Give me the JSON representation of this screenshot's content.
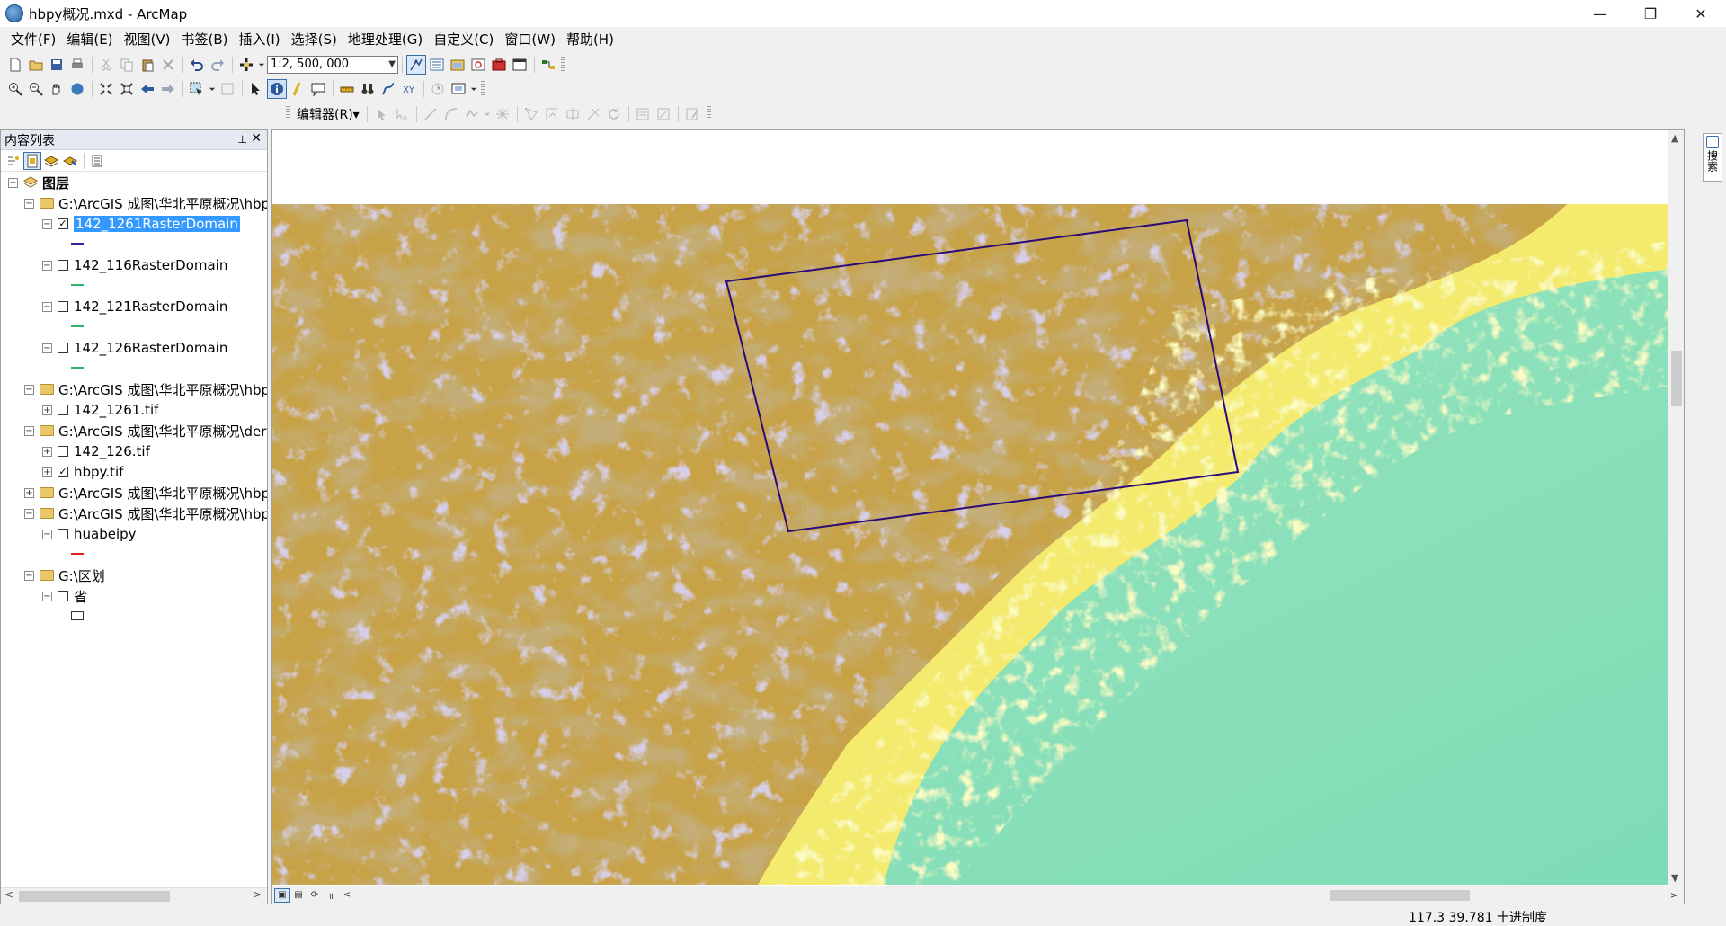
{
  "window": {
    "title": "hbpy概况.mxd - ArcMap",
    "controls": {
      "minimize": "—",
      "restore": "❐",
      "close": "✕"
    }
  },
  "menu": [
    "文件(F)",
    "编辑(E)",
    "视图(V)",
    "书签(B)",
    "插入(I)",
    "选择(S)",
    "地理处理(G)",
    "自定义(C)",
    "窗口(W)",
    "帮助(H)"
  ],
  "toolbar": {
    "scale_value": "1:2, 500, 000",
    "editor_label": "编辑器(R)▾"
  },
  "toc": {
    "title": "内容列表",
    "pin": "ᵖ",
    "close": "✕",
    "root_label": "图层",
    "items": [
      {
        "label": "G:\\ArcGIS 成图\\华北平原概况\\hbp"
      },
      {
        "label": "142_1261RasterDomain",
        "checked": true,
        "selected": true
      },
      {
        "label": "142_116RasterDomain"
      },
      {
        "label": "142_121RasterDomain"
      },
      {
        "label": "142_126RasterDomain"
      },
      {
        "label": "G:\\ArcGIS 成图\\华北平原概况\\hbp"
      },
      {
        "label": "142_1261.tif"
      },
      {
        "label": "G:\\ArcGIS 成图\\华北平原概况\\der"
      },
      {
        "label": "142_126.tif"
      },
      {
        "label": "hbpy.tif",
        "checked": true
      },
      {
        "label": "G:\\ArcGIS 成图\\华北平原概况\\hbp"
      },
      {
        "label": "G:\\ArcGIS 成图\\华北平原概况\\hbp"
      },
      {
        "label": "huabeipy"
      },
      {
        "label": "G:\\区划"
      },
      {
        "label": "省"
      }
    ],
    "legend_colors": {
      "domain_1261": "#3b1fa0",
      "domain_116": "#2fb36b",
      "domain_121": "#2fb36b",
      "domain_126": "#2fb36b",
      "huabeipy": "#e02020"
    }
  },
  "map": {
    "colors": {
      "plain": "#86dfb8",
      "lowland": "#f7f07a",
      "hills": "#c8a24a",
      "mountains": "#8a6a2a",
      "peaks": "#a89ccc",
      "outline": "#2a0a7a"
    }
  },
  "dock": {
    "search_label": "搜索"
  },
  "status": {
    "coordinates": "117.3  39.781 十进制度"
  }
}
